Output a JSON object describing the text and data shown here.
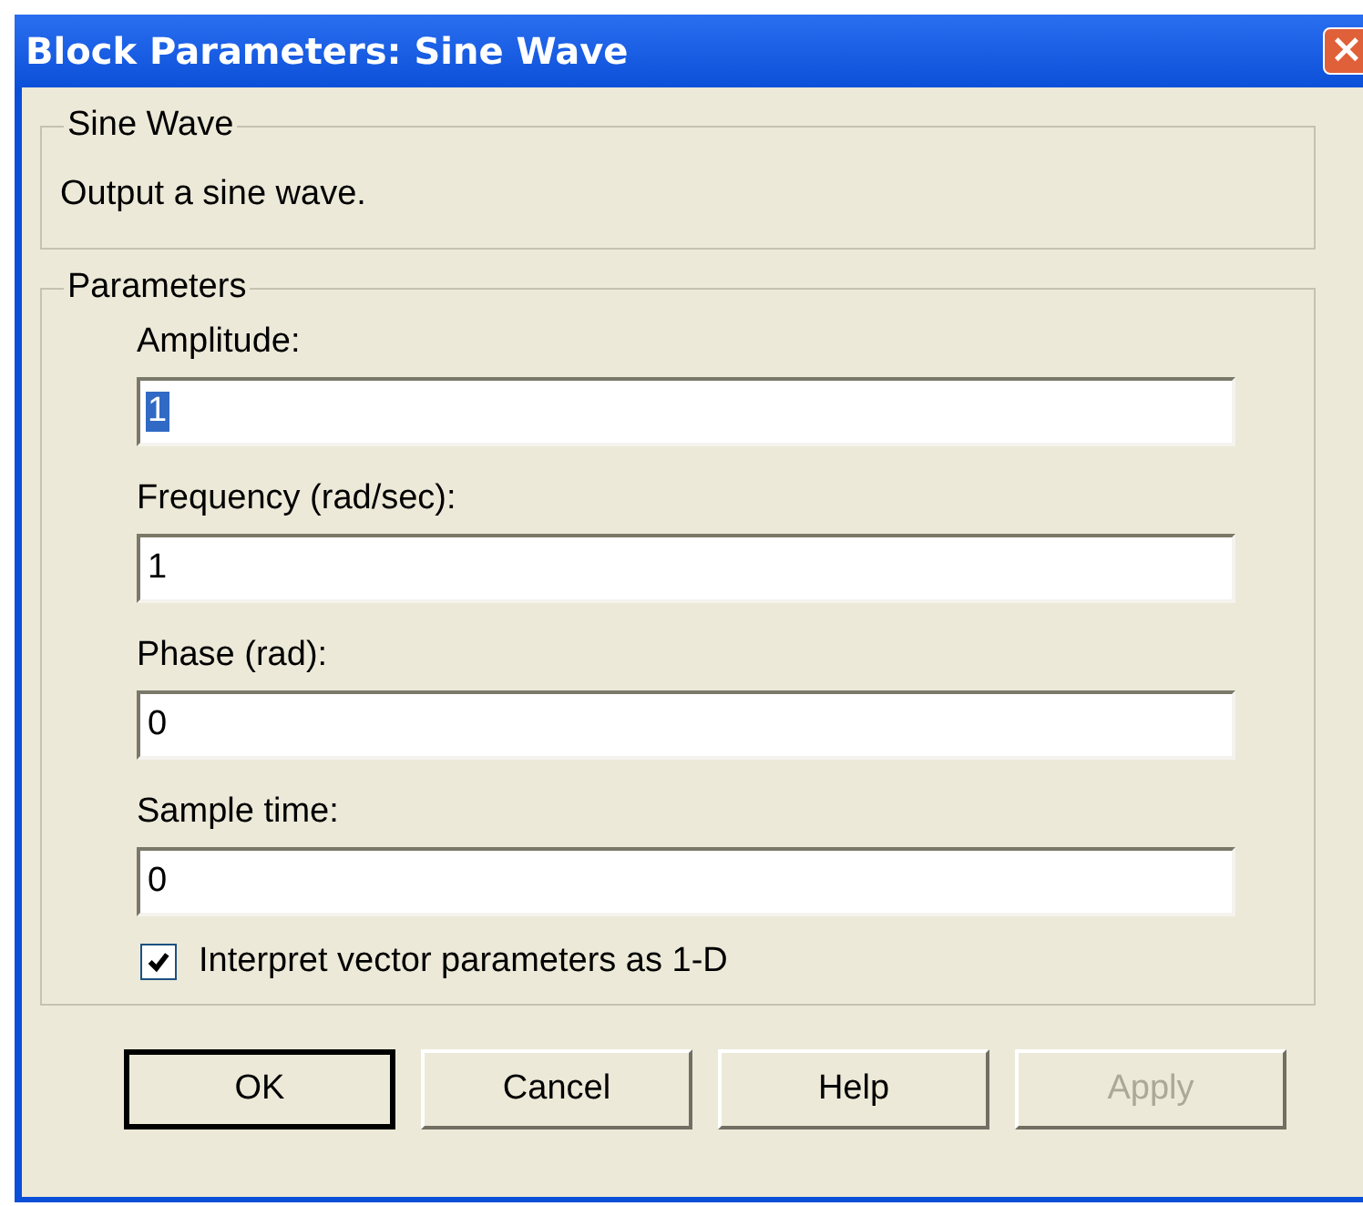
{
  "window": {
    "title": "Block Parameters: Sine Wave",
    "close": "×"
  },
  "description_group": {
    "title": "Sine Wave",
    "text": "Output a sine wave."
  },
  "parameters_group": {
    "title": "Parameters",
    "fields": [
      {
        "label": "Amplitude:",
        "value": "1",
        "text_selected": true
      },
      {
        "label": "Frequency (rad/sec):",
        "value": "1",
        "text_selected": false
      },
      {
        "label": "Phase (rad):",
        "value": "0",
        "text_selected": false
      },
      {
        "label": "Sample time:",
        "value": "0",
        "text_selected": false
      }
    ],
    "checkbox": {
      "label": "Interpret vector parameters as 1-D",
      "checked": true
    }
  },
  "buttons": [
    {
      "label": "OK",
      "default": true,
      "disabled": false
    },
    {
      "label": "Cancel",
      "default": false,
      "disabled": false
    },
    {
      "label": "Help",
      "default": false,
      "disabled": false
    },
    {
      "label": "Apply",
      "default": false,
      "disabled": true
    }
  ]
}
